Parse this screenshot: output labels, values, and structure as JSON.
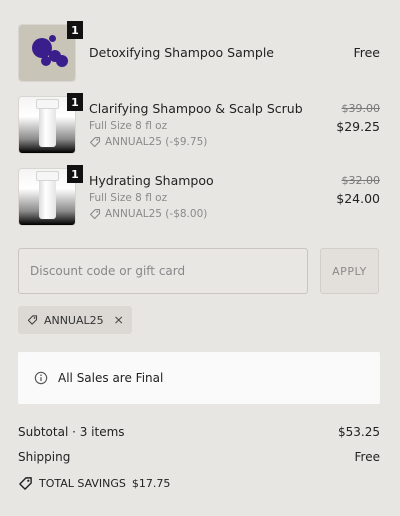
{
  "items": [
    {
      "name": "Detoxifying Shampoo Sample",
      "quantity": "1",
      "price": "Free",
      "thumb": "sample-dots-image"
    },
    {
      "name": "Clarifying Shampoo & Scalp Scrub",
      "quantity": "1",
      "size": "Full Size 8 fl oz",
      "discount": "ANNUAL25 (-$9.75)",
      "original_price": "$39.00",
      "price": "$29.25",
      "thumb": "white-bottle-image"
    },
    {
      "name": "Hydrating Shampoo",
      "quantity": "1",
      "size": "Full Size 8 fl oz",
      "discount": "ANNUAL25 (-$8.00)",
      "original_price": "$32.00",
      "price": "$24.00",
      "thumb": "white-bottle-image"
    }
  ],
  "discount": {
    "placeholder": "Discount code or gift card",
    "apply_label": "APPLY",
    "applied_code": "ANNUAL25"
  },
  "notice": {
    "text": "All Sales are Final"
  },
  "summary": {
    "subtotal_label": "Subtotal · 3 items",
    "subtotal_value": "$53.25",
    "shipping_label": "Shipping",
    "shipping_value": "Free",
    "savings_label": "TOTAL SAVINGS",
    "savings_value": "$17.75"
  },
  "colors": {
    "background": "#e8e6e3",
    "badge": "#111111",
    "sample_dots": "#3a1e8c"
  }
}
